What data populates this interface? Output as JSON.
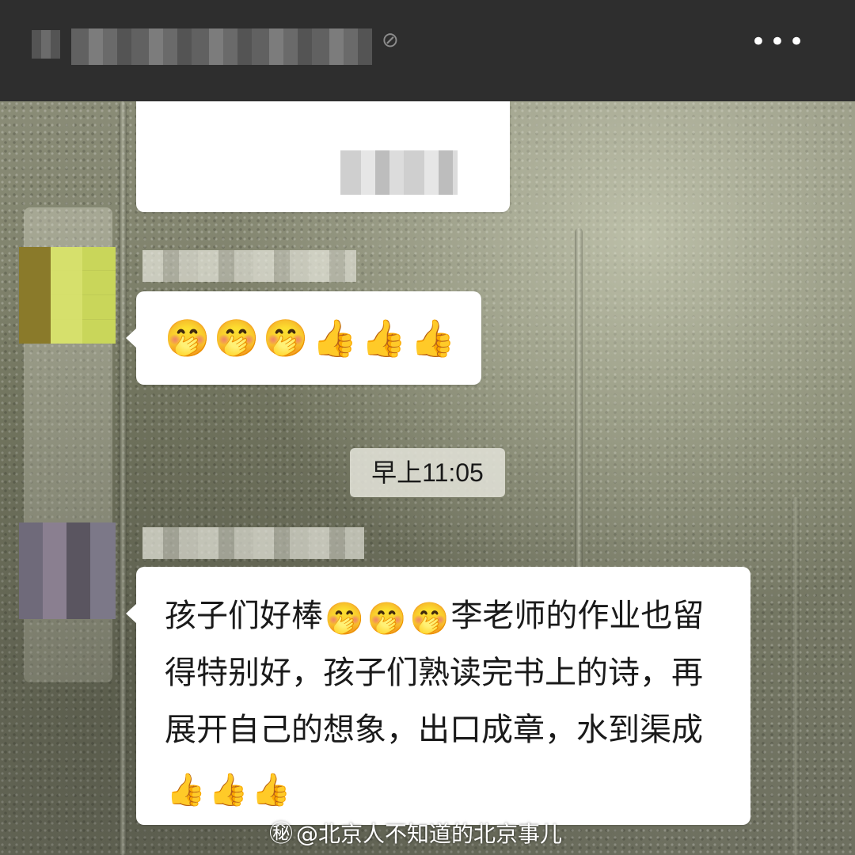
{
  "header": {
    "more_icon": "more-dots-icon",
    "more_glyph": "•••"
  },
  "messages": [
    {
      "type": "image-caption-bubble",
      "content": "blurred"
    },
    {
      "type": "emoji-bubble",
      "emojis": [
        "🤭",
        "🤭",
        "🤭",
        "👍",
        "👍",
        "👍"
      ]
    },
    {
      "type": "text-bubble",
      "parts": [
        "孩子们好棒",
        "🤭",
        "🤭",
        "🤭",
        "李老师的作业也留得特别好，孩子们熟读完书上的诗，再展开自己的想象，出口成章，水到渠成",
        "👍",
        "👍",
        "👍"
      ]
    }
  ],
  "timestamp": "早上11:05",
  "watermark": {
    "icon": "weibo-icon",
    "glyph": "㊙",
    "text": "@北京人不知道的北京事儿"
  },
  "colors": {
    "topbar": "#2e2e2e",
    "bubble": "#ffffff",
    "timestamp_bg": "#e1e1d7"
  }
}
